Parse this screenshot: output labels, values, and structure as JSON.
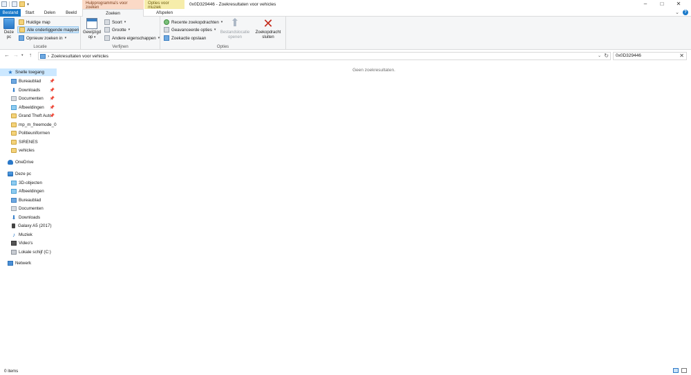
{
  "window": {
    "title": "0x0D329446 - Zoekresultaten voor vehicles",
    "context_tabs": {
      "search_tools": "Hulpprogramma's voor zoeken",
      "music_tools": "Opties voor muziek"
    },
    "controls": {
      "minimize": "–",
      "maximize": "□",
      "close": "✕"
    }
  },
  "tabs": [
    "Bestand",
    "Start",
    "Delen",
    "Beeld",
    "Zoeken",
    "Afspelen"
  ],
  "ribbon": {
    "location": {
      "label": "Locatie",
      "this_pc_line1": "Deze",
      "this_pc_line2": "pc",
      "current_folder": "Huidige map",
      "all_subfolders": "Alle onderliggende mappen",
      "search_again": "Opnieuw zoeken in"
    },
    "refine": {
      "label": "Verfijnen",
      "modified_line1": "Gewijzigd",
      "modified_line2": "op",
      "kind": "Soort",
      "size": "Grootte",
      "other_properties": "Andere eigenschappen"
    },
    "options": {
      "label": "Opties",
      "recent_searches": "Recente zoekopdrachten",
      "advanced_options": "Geavanceerde opties",
      "save_search": "Zoekactie opslaan",
      "open_location_line1": "Bestandslocatie",
      "open_location_line2": "openen",
      "close_search_line1": "Zoekopdracht",
      "close_search_line2": "sluiten"
    }
  },
  "address": {
    "path": "Zoekresultaten voor vehicles",
    "separator": "›",
    "search_value": "0x0D329446"
  },
  "nav": {
    "quick_access": "Snelle toegang",
    "quick_items": [
      {
        "label": "Bureaublad",
        "pinned": true
      },
      {
        "label": "Downloads",
        "pinned": true
      },
      {
        "label": "Documenten",
        "pinned": true
      },
      {
        "label": "Afbeeldingen",
        "pinned": true
      },
      {
        "label": "Grand Theft Auto",
        "pinned": true
      },
      {
        "label": "mp_m_freemode_01",
        "pinned": false
      },
      {
        "label": "Politieuniformen",
        "pinned": false
      },
      {
        "label": "SIRENES",
        "pinned": false
      },
      {
        "label": "vehicles",
        "pinned": false
      }
    ],
    "onedrive": "OneDrive",
    "this_pc": "Deze pc",
    "pc_items": [
      "3D-objecten",
      "Afbeeldingen",
      "Bureaublad",
      "Documenten",
      "Downloads",
      "Galaxy A5 (2017)",
      "Muziek",
      "Video's",
      "Lokale schijf (C:)"
    ],
    "network": "Netwerk",
    "pin_glyph": "📌"
  },
  "content": {
    "empty_message": "Geen zoekresultaten."
  },
  "status": {
    "item_count": "0 items"
  }
}
